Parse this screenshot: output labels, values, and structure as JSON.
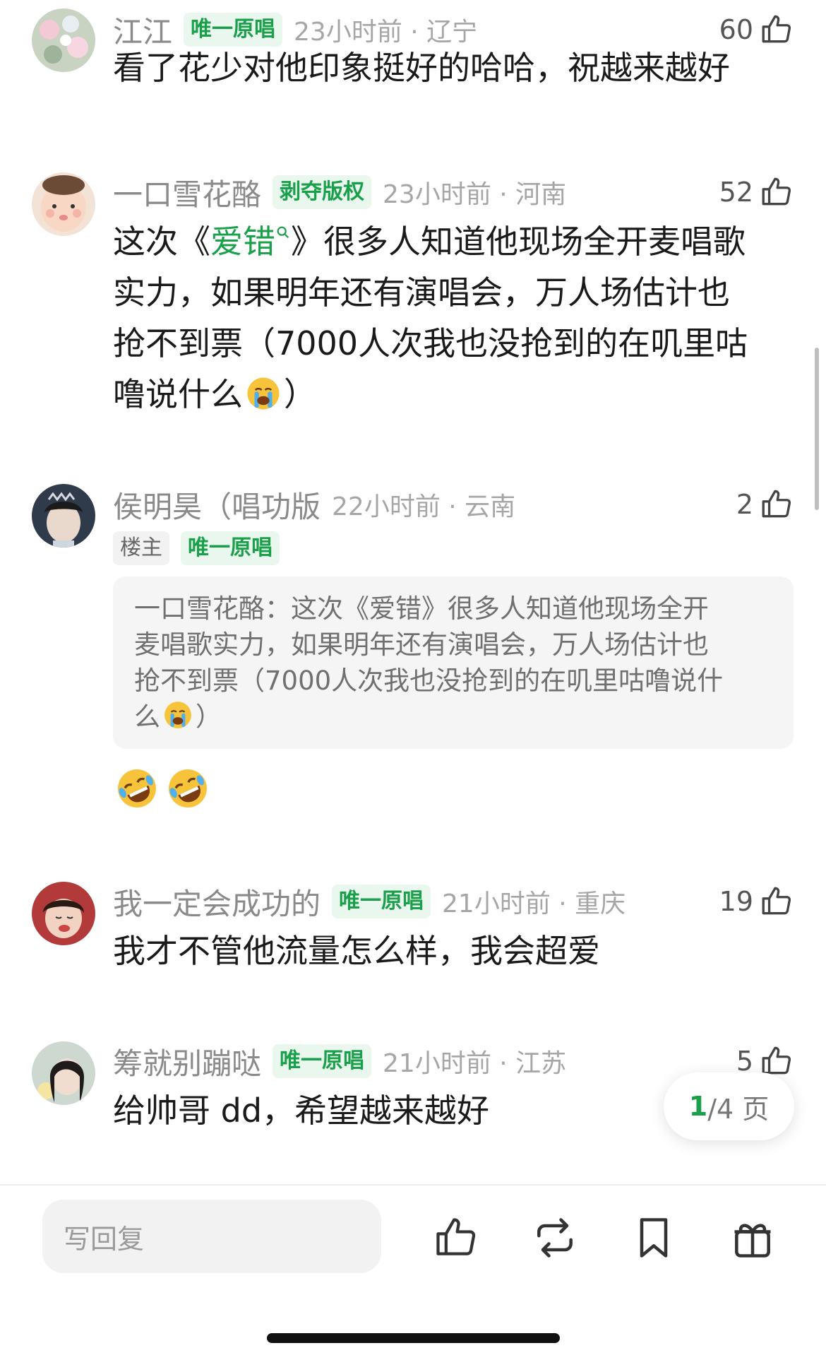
{
  "comments": [
    {
      "name": "江江",
      "badges": [
        "唯一原唱"
      ],
      "meta": "23小时前 · 辽宁",
      "likes": "60",
      "text": "看了花少对他印象挺好的哈哈，祝越来越好"
    },
    {
      "name": "一口雪花酪",
      "badges": [
        "剥夺版权"
      ],
      "meta": "23小时前 · 河南",
      "likes": "52",
      "text_before": "这次《",
      "text_link": "爱错",
      "text_after_line1": "》很多人知道他现场全开麦唱歌",
      "text_line2": "实力，如果明年还有演唱会，万人场估计也",
      "text_line3": "抢不到票（7000人次我也没抢到的在叽里咕",
      "text_line4": "噜说什么",
      "text_end": "）",
      "emoji": "loudly-crying-face"
    },
    {
      "name": "侯明昊（唱功版",
      "badges": [
        "楼主",
        "唯一原唱"
      ],
      "meta": "22小时前 · 云南",
      "likes": "2",
      "quote_line1": "一口雪花酪：这次《爱错》很多人知道他现场全开",
      "quote_line2": "麦唱歌实力，如果明年还有演唱会，万人场估计也",
      "quote_line3": "抢不到票（7000人次我也没抢到的在叽里咕噜说什",
      "quote_line4": "么",
      "quote_end": "）",
      "reply_emojis": [
        "rolling-on-floor-laughing",
        "rolling-on-floor-laughing"
      ]
    },
    {
      "name": "我一定会成功的",
      "badges": [
        "唯一原唱"
      ],
      "meta": "21小时前 · 重庆",
      "likes": "19",
      "text": "我才不管他流量怎么样，我会超爱"
    },
    {
      "name": "筹就别蹦哒",
      "badges": [
        "唯一原唱"
      ],
      "meta": "21小时前 · 江苏",
      "likes": "5",
      "text": "给帅哥 dd，希望越来越好"
    }
  ],
  "pager": {
    "current": "1",
    "rest": "/4 页"
  },
  "bottom_bar": {
    "reply_placeholder": "写回复",
    "icons": [
      "thumbs-up-icon",
      "repost-icon",
      "bookmark-icon",
      "gift-icon"
    ]
  },
  "colors": {
    "accent": "#1aa04a",
    "badge_bg": "#e9f7ee"
  }
}
